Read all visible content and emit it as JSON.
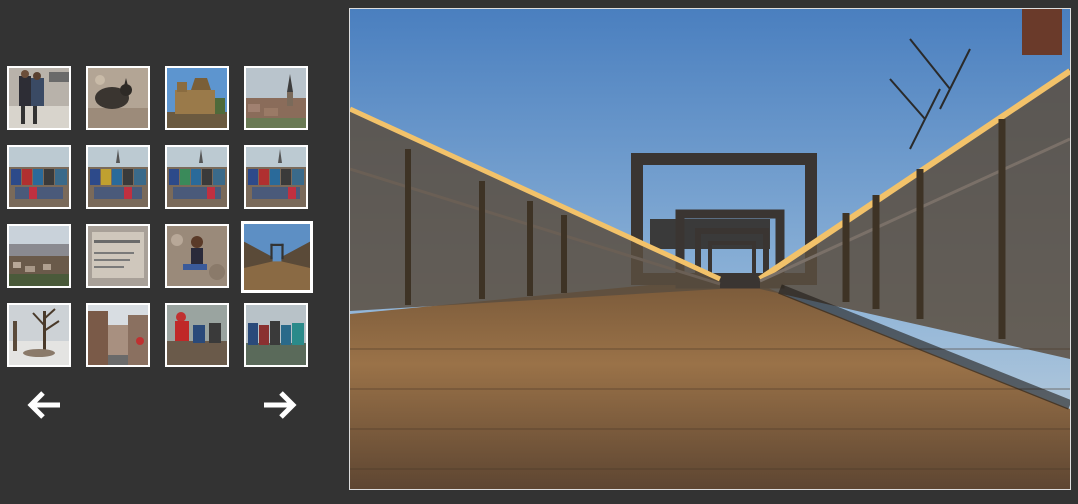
{
  "gallery": {
    "thumbnails": [
      {
        "icon": "people-in-snow-thumbnail"
      },
      {
        "icon": "animal-on-rocks-thumbnail"
      },
      {
        "icon": "castle-thumbnail"
      },
      {
        "icon": "town-church-thumbnail"
      },
      {
        "icon": "group-photo-thumbnail"
      },
      {
        "icon": "group-photo-thumbnail"
      },
      {
        "icon": "group-photo-thumbnail"
      },
      {
        "icon": "group-photo-thumbnail"
      },
      {
        "icon": "valley-town-thumbnail"
      },
      {
        "icon": "museum-sign-thumbnail"
      },
      {
        "icon": "girl-sitting-thumbnail"
      },
      {
        "icon": "bridge-thumbnail"
      },
      {
        "icon": "snowy-tree-thumbnail"
      },
      {
        "icon": "old-street-thumbnail"
      },
      {
        "icon": "hikers-thumbnail"
      },
      {
        "icon": "hikers-group-thumbnail"
      }
    ],
    "selected_index": 11,
    "prev_icon": "arrow-left-icon",
    "next_icon": "arrow-right-icon",
    "main_image_icon": "bridge-photo"
  },
  "colors": {
    "background": "#333333",
    "thumb_border": "#ffffff",
    "arrow": "#ffffff"
  }
}
